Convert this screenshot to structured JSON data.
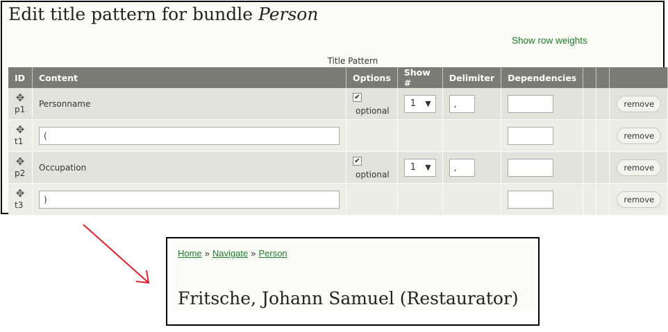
{
  "page": {
    "title_prefix": "Edit title pattern for bundle ",
    "title_bundle": "Person",
    "show_row_weights": "Show row weights",
    "table_caption": "Title Pattern"
  },
  "table": {
    "headers": [
      "ID",
      "Content",
      "Options",
      "Show #",
      "Delimiter",
      "Dependencies",
      "",
      "",
      ""
    ],
    "rows": [
      {
        "id": "p1",
        "content": "Personname",
        "option_label": "optional",
        "show": "1",
        "delimiter": ",",
        "dependencies": "",
        "remove": "remove"
      },
      {
        "id": "t1",
        "content": "(",
        "dependencies": "",
        "remove": "remove"
      },
      {
        "id": "p2",
        "content": "Occupation",
        "option_label": "optional",
        "show": "1",
        "delimiter": ",",
        "dependencies": "",
        "remove": "remove"
      },
      {
        "id": "t3",
        "content": ")",
        "dependencies": "",
        "remove": "remove"
      }
    ]
  },
  "icons": {
    "drag": "✥",
    "check": "✔",
    "select_arrow": "▼"
  },
  "colors": {
    "header_bg": "#7b7a73",
    "link_green": "#1f7a2a",
    "arrow_red": "#e0202a"
  },
  "result": {
    "breadcrumb": {
      "home": "Home",
      "sep": "»",
      "navigate": "Navigate",
      "person": "Person"
    },
    "title": "Fritsche, Johann Samuel (Restaurator)"
  }
}
